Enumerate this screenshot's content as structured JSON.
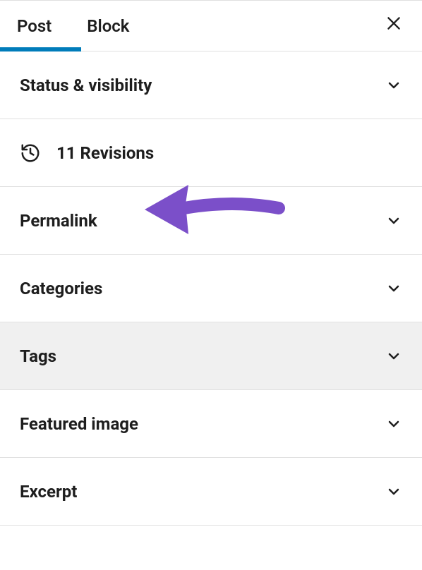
{
  "tabs": {
    "post": "Post",
    "block": "Block"
  },
  "sections": {
    "status_visibility": "Status & visibility",
    "revisions": "11 Revisions",
    "permalink": "Permalink",
    "categories": "Categories",
    "tags": "Tags",
    "featured_image": "Featured image",
    "excerpt": "Excerpt"
  },
  "colors": {
    "accent": "#007cba",
    "arrow": "#7b4fc9"
  }
}
